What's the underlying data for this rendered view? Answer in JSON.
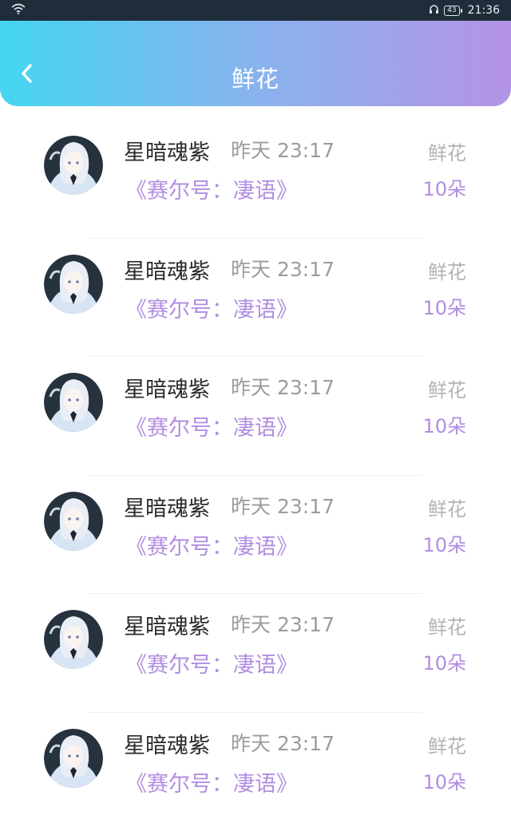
{
  "status_bar": {
    "battery": "43",
    "time": "21:36"
  },
  "header": {
    "title": "鲜花"
  },
  "items": [
    {
      "name": "星暗魂紫",
      "time": "昨天 23:17",
      "book": "《赛尔号：凄语》",
      "gift_type": "鲜花",
      "gift_count": "10朵"
    },
    {
      "name": "星暗魂紫",
      "time": "昨天 23:17",
      "book": "《赛尔号：凄语》",
      "gift_type": "鲜花",
      "gift_count": "10朵"
    },
    {
      "name": "星暗魂紫",
      "time": "昨天 23:17",
      "book": "《赛尔号：凄语》",
      "gift_type": "鲜花",
      "gift_count": "10朵"
    },
    {
      "name": "星暗魂紫",
      "time": "昨天 23:17",
      "book": "《赛尔号：凄语》",
      "gift_type": "鲜花",
      "gift_count": "10朵"
    },
    {
      "name": "星暗魂紫",
      "time": "昨天 23:17",
      "book": "《赛尔号：凄语》",
      "gift_type": "鲜花",
      "gift_count": "10朵"
    },
    {
      "name": "星暗魂紫",
      "time": "昨天 23:17",
      "book": "《赛尔号：凄语》",
      "gift_type": "鲜花",
      "gift_count": "10朵"
    }
  ],
  "colors": {
    "header_gradient_start": "#45d6f1",
    "header_gradient_end": "#b493e6",
    "accent": "#b18ee0"
  }
}
